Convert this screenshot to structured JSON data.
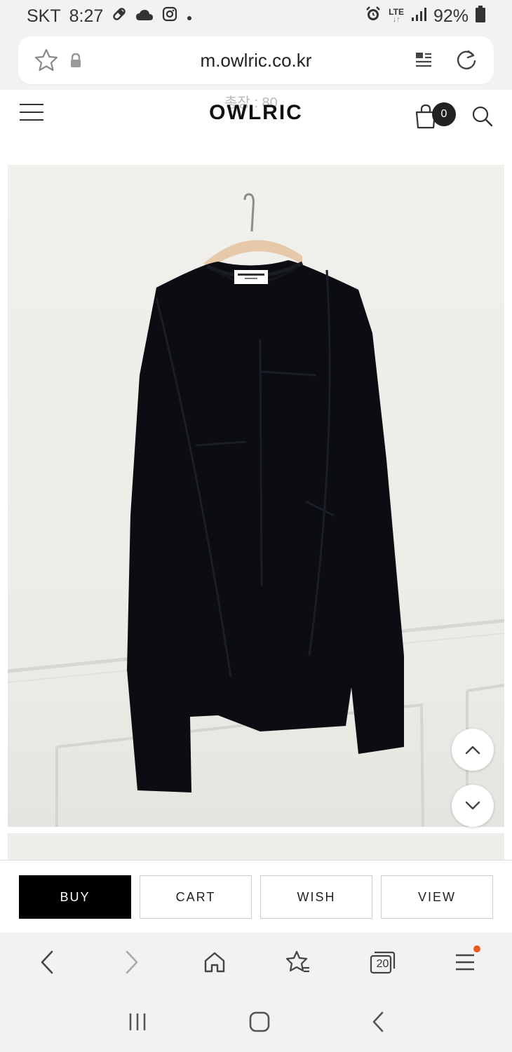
{
  "status_bar": {
    "carrier": "SKT",
    "time": "8:27",
    "network": "LTE",
    "battery": "92%",
    "icons": [
      "pill-icon",
      "cloud-icon",
      "instagram-icon",
      "dot-icon",
      "alarm-icon",
      "signal-icon",
      "battery-icon"
    ]
  },
  "browser": {
    "url": "m.owlric.co.kr",
    "icons": [
      "bookmark-star-icon",
      "lock-icon",
      "reader-mode-icon",
      "reload-icon"
    ]
  },
  "header": {
    "logo": "OWLRIC",
    "overlay_text": "총장 : 80",
    "cart_count": "0",
    "icons": [
      "menu-icon",
      "cart-icon",
      "search-icon"
    ]
  },
  "product": {
    "image_alt": "black knit sweater on hanger",
    "colors": {
      "sweater": "#0b0d12",
      "wall": "#efeeea"
    }
  },
  "actions": {
    "buy": "BUY",
    "cart": "CART",
    "wish": "WISH",
    "view": "VIEW"
  },
  "bottom_bar": {
    "tabs_count": "20",
    "icons": [
      "back-icon",
      "forward-icon",
      "home-icon",
      "bookmarks-icon",
      "tabs-icon",
      "menu-icon"
    ],
    "notification_color": "#f05a22"
  },
  "system_nav": {
    "icons": [
      "recent-apps-icon",
      "home-button-icon",
      "back-button-icon"
    ]
  }
}
